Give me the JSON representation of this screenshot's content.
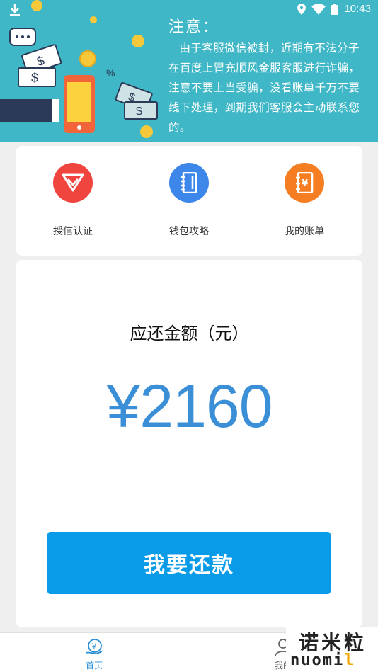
{
  "status_bar": {
    "time": "10:43"
  },
  "notice": {
    "title": "注意：",
    "text": "由于客服微信被封，近期有不法分子在百度上冒充顺风金服客服进行诈骗，注意不要上当受骗，没看账单千万不要线下处理，到期我们客服会主动联系您的。"
  },
  "quick_actions": [
    {
      "label": "授信认证",
      "icon": "diamond-icon",
      "color": "#f0453f"
    },
    {
      "label": "钱包攻略",
      "icon": "notebook-icon",
      "color": "#3d86ea"
    },
    {
      "label": "我的账单",
      "icon": "bill-icon",
      "color": "#f57e22"
    }
  ],
  "repayment": {
    "label": "应还金额（元）",
    "amount": "¥2160",
    "button_label": "我要还款"
  },
  "tabs": [
    {
      "label": "首页",
      "icon": "home-yen-icon",
      "active": true
    },
    {
      "label": "我的",
      "icon": "user-icon",
      "active": false
    }
  ],
  "watermark": {
    "cn": "诺米粒",
    "en_main": "nuomi",
    "en_accent": "l"
  },
  "colors": {
    "banner": "#3fb7c6",
    "accent": "#0a9be8",
    "amount": "#3b8fd6",
    "tab_active": "#2a8fd8"
  }
}
